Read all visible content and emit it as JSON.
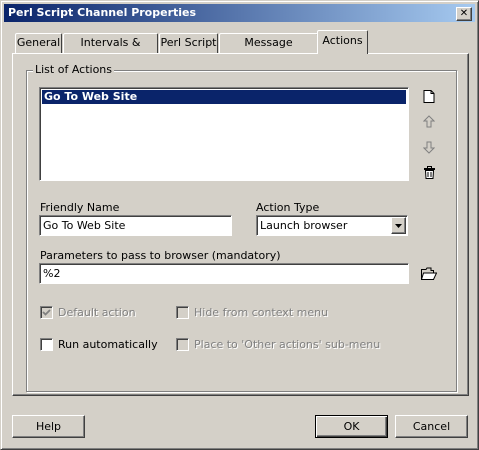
{
  "window": {
    "title": "Perl Script Channel Properties",
    "close_glyph": "✕"
  },
  "tabs": [
    {
      "label": "General",
      "active": false
    },
    {
      "label": "Intervals & Alerts",
      "active": false
    },
    {
      "label": "Perl Script",
      "active": false
    },
    {
      "label": "Message Template",
      "active": false
    },
    {
      "label": "Actions",
      "active": true
    }
  ],
  "actions": {
    "group_label": "List of Actions",
    "list_items": [
      {
        "label": "Go To Web Site",
        "selected": true
      }
    ],
    "icons": [
      "new-icon",
      "arrow-up-icon",
      "arrow-down-icon",
      "trash-icon"
    ]
  },
  "fields": {
    "friendly_name_label": "Friendly Name",
    "friendly_name_value": "Go To Web Site",
    "action_type_label": "Action Type",
    "action_type_value": "Launch browser",
    "params_label": "Parameters to pass to browser (mandatory)",
    "params_value": "%2"
  },
  "checkboxes": {
    "default_action": {
      "label": "Default action",
      "checked": true,
      "enabled": false
    },
    "hide_context": {
      "label": "Hide from context menu",
      "checked": false,
      "enabled": false
    },
    "run_auto": {
      "label": "Run automatically",
      "checked": false,
      "enabled": true
    },
    "place_other": {
      "label": "Place to 'Other actions' sub-menu",
      "checked": false,
      "enabled": false
    }
  },
  "buttons": {
    "help": "Help",
    "ok": "OK",
    "cancel": "Cancel"
  },
  "colors": {
    "selection": "#0a246a",
    "face": "#d4d0c8"
  }
}
